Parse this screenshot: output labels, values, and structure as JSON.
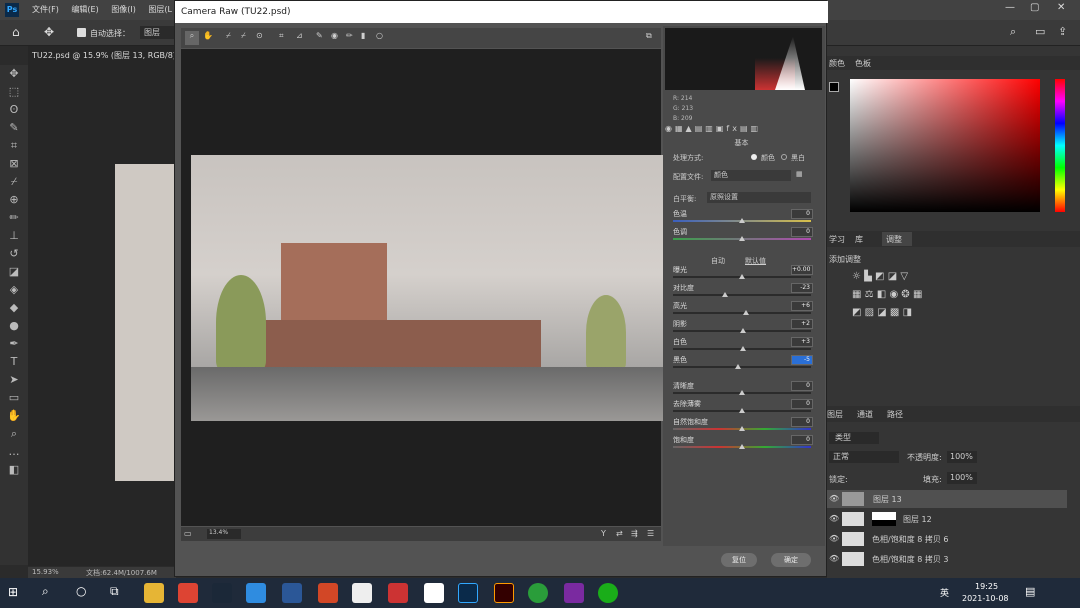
{
  "menubar": {
    "items": [
      "文件(F)",
      "编辑(E)",
      "图像(I)",
      "图层(L"
    ]
  },
  "options": {
    "autoselect": "自动选择：",
    "target": "图层"
  },
  "doc": {
    "tab": "TU22.psd @ 15.9% (图层 13, RGB/8)",
    "zoom": "15.93%",
    "docsize": "文档:62.4M/1007.6M"
  },
  "dialog": {
    "title": "Camera Raw (TU22.psd)",
    "zoom_value": "13.4%",
    "basic_heading": "基本",
    "treatment_label": "处理方式:",
    "treatment_color": "颜色",
    "treatment_bw": "黑白",
    "profile_label": "配置文件:",
    "profile_value": "颜色",
    "wb_label": "白平衡:",
    "wb_value": "原照设置",
    "auto": "自动",
    "default": "默认值",
    "rgb": {
      "r": "R:   214",
      "g": "G:   213",
      "b": "B:   209"
    },
    "sliders": [
      {
        "label": "色温",
        "value": "0",
        "pos": 0.5
      },
      {
        "label": "色调",
        "value": "0",
        "pos": 0.5
      },
      {
        "label": "曝光",
        "value": "+0.00",
        "pos": 0.5
      },
      {
        "label": "对比度",
        "value": "-23",
        "pos": 0.38
      },
      {
        "label": "高光",
        "value": "+6",
        "pos": 0.53
      },
      {
        "label": "阴影",
        "value": "+2",
        "pos": 0.51
      },
      {
        "label": "白色",
        "value": "+3",
        "pos": 0.51
      },
      {
        "label": "黑色",
        "value": "-5",
        "pos": 0.47
      },
      {
        "label": "清晰度",
        "value": "0",
        "pos": 0.5
      },
      {
        "label": "去除薄雾",
        "value": "0",
        "pos": 0.5
      },
      {
        "label": "自然饱和度",
        "value": "0",
        "pos": 0.5
      },
      {
        "label": "饱和度",
        "value": "0",
        "pos": 0.5
      }
    ],
    "cancel": "复位",
    "ok": "确定"
  },
  "right": {
    "color_tabs": [
      "颜色",
      "色板"
    ],
    "adj_tabs": [
      "学习",
      "库",
      "调整"
    ],
    "adj_title": "添加调整",
    "layers_tabs": [
      "图层",
      "通道",
      "路径"
    ],
    "kind": "类型",
    "blend": "正常",
    "opacity_label": "不透明度:",
    "opacity": "100%",
    "lock_label": "锁定:",
    "fill_label": "填充:",
    "fill": "100%",
    "layers": [
      "图层 13",
      "图层 12",
      "色相/饱和度 8 拷贝 6",
      "色相/饱和度 8 拷贝 3"
    ]
  },
  "taskbar": {
    "time": "19:25",
    "date": "2021-10-08",
    "ime": "英"
  }
}
